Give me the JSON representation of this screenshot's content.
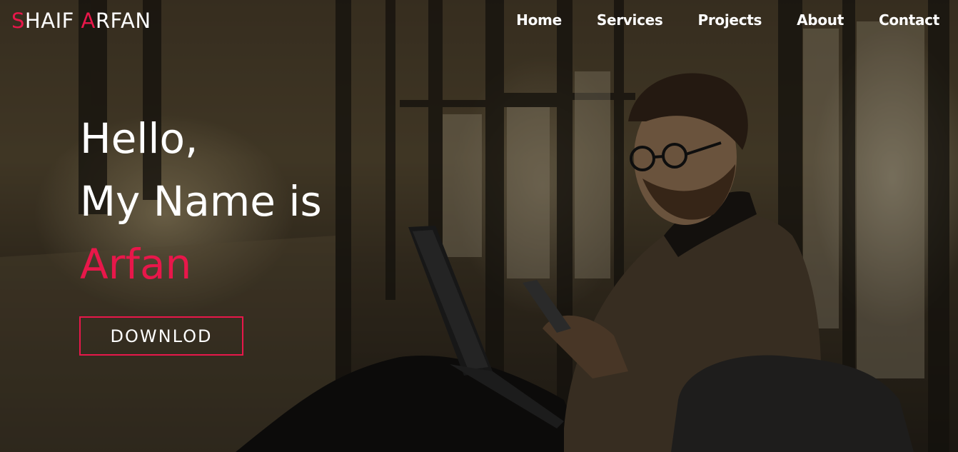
{
  "brand": {
    "first_initial": "S",
    "first_rest": "HAIF ",
    "last_initial": "A",
    "last_rest": "RFAN"
  },
  "nav": {
    "items": [
      {
        "label": "Home"
      },
      {
        "label": "Services"
      },
      {
        "label": "Projects"
      },
      {
        "label": "About"
      },
      {
        "label": "Contact"
      }
    ]
  },
  "hero": {
    "line1": "Hello,",
    "line2": "My Name is",
    "name": "Arfan",
    "button_label": "DOWNLOD"
  },
  "colors": {
    "accent": "#e8174a",
    "text": "#ffffff"
  }
}
